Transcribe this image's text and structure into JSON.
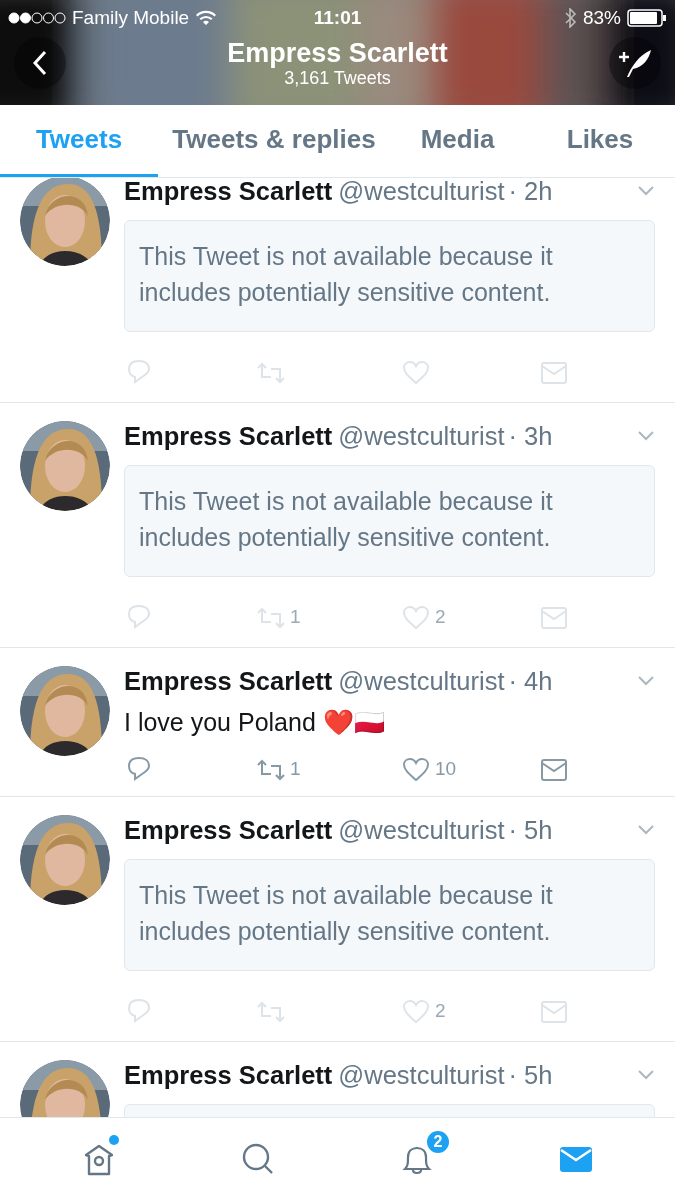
{
  "status_bar": {
    "carrier": "Family Mobile",
    "time": "11:01",
    "battery": "83%"
  },
  "header": {
    "title": "Empress Scarlett",
    "subtitle": "3,161 Tweets"
  },
  "tabs": [
    {
      "label": "Tweets",
      "selected": true
    },
    {
      "label": "Tweets & replies",
      "selected": false
    },
    {
      "label": "Media",
      "selected": false
    },
    {
      "label": "Likes",
      "selected": false
    }
  ],
  "tweets": [
    {
      "kind": "withheld",
      "name": "Empress Scarlett",
      "handle": "@westculturist",
      "time": "· 2h",
      "notice": "This Tweet is not available because it includes potentially sensitive content."
    },
    {
      "kind": "withheld",
      "name": "Empress Scarlett",
      "handle": "@westculturist",
      "time": "· 3h",
      "notice": "This Tweet is not available because it includes potentially sensitive content.",
      "retweets": "1",
      "likes": "2"
    },
    {
      "kind": "text",
      "name": "Empress Scarlett",
      "handle": "@westculturist",
      "time": "· 4h",
      "text": "I love you Poland ❤️🇵🇱",
      "retweets": "1",
      "likes": "10"
    },
    {
      "kind": "withheld",
      "name": "Empress Scarlett",
      "handle": "@westculturist",
      "time": "· 5h",
      "notice": "This Tweet is not available because it includes potentially sensitive content.",
      "likes": "2"
    },
    {
      "kind": "withheld",
      "name": "Empress Scarlett",
      "handle": "@westculturist",
      "time": "· 5h"
    }
  ],
  "bottom_nav": [
    {
      "kind": "home",
      "selected": false,
      "dot": true
    },
    {
      "kind": "search",
      "selected": false
    },
    {
      "kind": "notifications",
      "selected": false,
      "badge": "2"
    },
    {
      "kind": "messages",
      "selected": true
    }
  ]
}
